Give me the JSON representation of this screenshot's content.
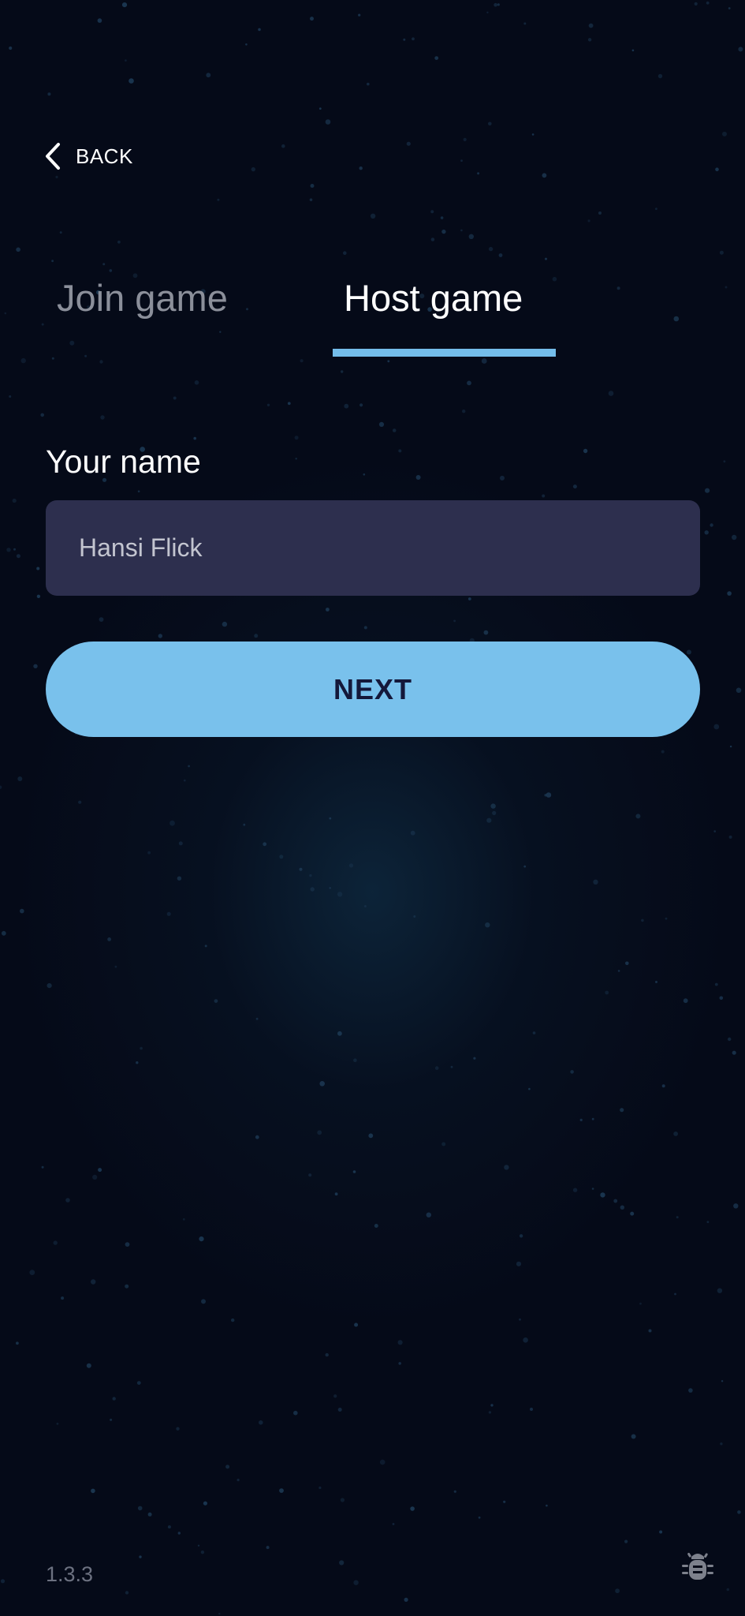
{
  "header": {
    "back_label": "BACK",
    "back_icon": "chevron-left-icon"
  },
  "tabs": [
    {
      "label": "Join game",
      "active": false
    },
    {
      "label": "Host game",
      "active": true
    }
  ],
  "form": {
    "name_label": "Your name",
    "name_value": "Hansi Flick",
    "next_label": "NEXT"
  },
  "footer": {
    "version": "1.3.3",
    "bug_icon": "bug-icon"
  },
  "colors": {
    "background": "#050a18",
    "accent": "#79c1ec",
    "input_background": "#2d2f4e",
    "button_text": "#14183a",
    "inactive_tab": "#8b8f9a"
  }
}
